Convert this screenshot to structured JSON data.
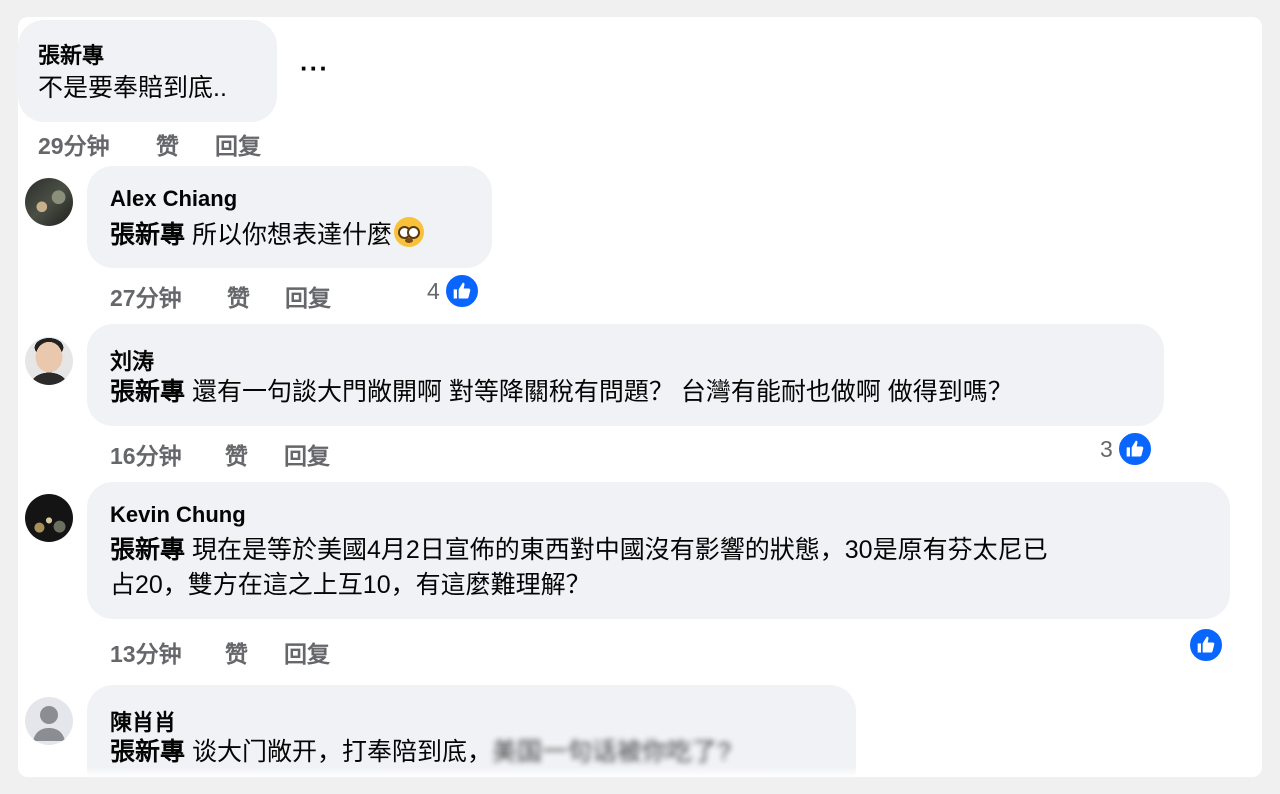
{
  "comments": [
    {
      "author": "張新專",
      "text": "不是要奉賠到底..",
      "time": "29分钟",
      "like": "赞",
      "reply": "回复",
      "more": "···"
    },
    {
      "author": "Alex Chiang",
      "mention": "張新專",
      "text": "所以你想表達什麼",
      "emoji": "flushed-face",
      "time": "27分钟",
      "like": "赞",
      "reply": "回复",
      "reactions": "4"
    },
    {
      "author": "刘涛",
      "mention": "張新專",
      "text": "還有一句談大門敞開啊 對等降關稅有問題？ 台灣有能耐也做啊 做得到嗎？",
      "time": "16分钟",
      "like": "赞",
      "reply": "回复",
      "reactions": "3"
    },
    {
      "author": "Kevin Chung",
      "mention": "張新專",
      "text_line1": "現在是等於美國4月2日宣佈的東西對中國沒有影響的狀態，30是原有芬太尼已",
      "text_line2": "占20，雙方在這之上互10，有這麼難理解？",
      "time": "13分钟",
      "like": "赞",
      "reply": "回复"
    },
    {
      "author": "陳肖肖",
      "mention": "張新專",
      "text_visible": "谈大门敞开，打奉陪到底，",
      "text_obscured": "美国一句话被你吃了?"
    }
  ],
  "colors": {
    "like_blue": "#0866ff",
    "bubble_bg": "#f0f2f5",
    "meta_gray": "#65676b"
  }
}
